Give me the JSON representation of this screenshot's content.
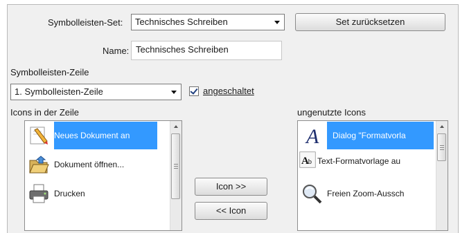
{
  "toolbar_set": {
    "label": "Symbolleisten-Set:",
    "value": "Technisches Schreiben",
    "reset_button": "Set zurücksetzen"
  },
  "name_field": {
    "label": "Name:",
    "value": "Technisches Schreiben"
  },
  "row_section": {
    "heading": "Symbolleisten-Zeile",
    "selected_row": "1. Symbolleisten-Zeile",
    "checkbox_label": "angeschaltet",
    "checked": true
  },
  "icons_in_row": {
    "heading": "Icons in der Zeile",
    "items": [
      {
        "label": "Neues Dokument an",
        "icon": "new-document-pencil-icon",
        "selected": true
      },
      {
        "label": "Dokument öffnen...",
        "icon": "open-folder-icon",
        "selected": false
      },
      {
        "label": "Drucken",
        "icon": "printer-icon",
        "selected": false
      }
    ]
  },
  "move_buttons": {
    "add": "Icon >>",
    "remove": "<< Icon"
  },
  "unused_icons": {
    "heading": "ungenutzte Icons",
    "items": [
      {
        "label": "Dialog \"Formatvorla",
        "icon": "italic-a-format-icon",
        "selected": true
      },
      {
        "label": "Text-Formatvorlage au",
        "icon": "text-style-ab-icon",
        "selected": false
      },
      {
        "label": "Freien Zoom-Aussch",
        "icon": "magnifier-zoom-icon",
        "selected": false
      }
    ]
  },
  "colors": {
    "selection": "#3399ff",
    "panel": "#f0f0f0"
  }
}
